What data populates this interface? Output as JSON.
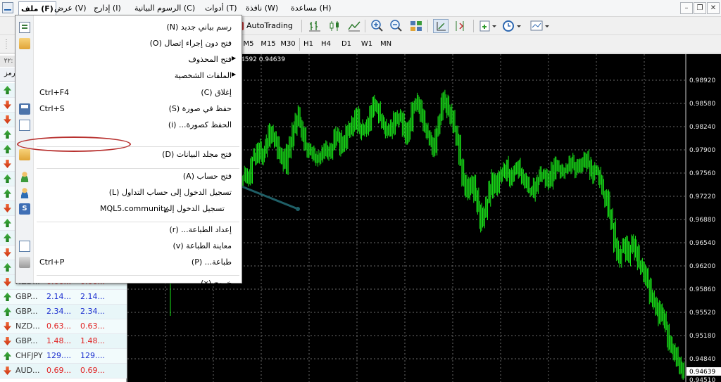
{
  "menubar": {
    "items": [
      {
        "label": "ملف (F)",
        "key": "file"
      },
      {
        "label": "عرض (V)",
        "key": "view"
      },
      {
        "label": "إدارج (I)",
        "key": "insert"
      },
      {
        "label": "الرسوم البيانية (C)",
        "key": "charts"
      },
      {
        "label": "أدوات (T)",
        "key": "tools"
      },
      {
        "label": "نافذة (W)",
        "key": "window"
      },
      {
        "label": "مساعدة (H)",
        "key": "help"
      }
    ]
  },
  "toolbar": {
    "autotrading_label": "AutoTrading",
    "search_placeholder": "",
    "search_value": "",
    "mql_badge": "5",
    "timeframes": [
      "M5",
      "M15",
      "M30",
      "H1",
      "H4",
      "D1",
      "W1",
      "MN"
    ]
  },
  "chart_info": "4592 0.94639",
  "chart_data": {
    "type": "bar",
    "yticks": [
      "0.98920",
      "0.98580",
      "0.98240",
      "0.97900",
      "0.97560",
      "0.97220",
      "0.96880",
      "0.96540",
      "0.96200",
      "0.95860",
      "0.95520",
      "0.95180",
      "0.94840",
      "0.94639",
      "0.94510"
    ],
    "current_price": "0.94639",
    "ylim": [
      0.9451,
      0.9918
    ],
    "closes": [
      0.976,
      0.977,
      0.9765,
      0.979,
      0.98,
      0.981,
      0.9795,
      0.9805,
      0.982,
      0.9835,
      0.983,
      0.9815,
      0.98,
      0.9795,
      0.978,
      0.98,
      0.982,
      0.984,
      0.986,
      0.985,
      0.9835,
      0.9815,
      0.981,
      0.9805,
      0.9795,
      0.979,
      0.98,
      0.981,
      0.9805,
      0.98,
      0.9815,
      0.983,
      0.9825,
      0.981,
      0.9815,
      0.983,
      0.984,
      0.985,
      0.986,
      0.9845,
      0.9835,
      0.984,
      0.985,
      0.987,
      0.988,
      0.9875,
      0.986,
      0.985,
      0.984,
      0.9835,
      0.9845,
      0.9855,
      0.986,
      0.9855,
      0.984,
      0.983,
      0.9845,
      0.987,
      0.988,
      0.9875,
      0.986,
      0.984,
      0.983,
      0.982,
      0.981,
      0.9835,
      0.9855,
      0.988,
      0.9885,
      0.987,
      0.986,
      0.984,
      0.982,
      0.979,
      0.976,
      0.974,
      0.975,
      0.976,
      0.974,
      0.972,
      0.969,
      0.971,
      0.973,
      0.9745,
      0.976,
      0.975,
      0.9765,
      0.977,
      0.978,
      0.977,
      0.976,
      0.9775,
      0.978,
      0.977,
      0.976,
      0.975,
      0.9745,
      0.974,
      0.975,
      0.976,
      0.977,
      0.9765,
      0.9755,
      0.976,
      0.9775,
      0.9785,
      0.978,
      0.977,
      0.9775,
      0.978,
      0.979,
      0.9785,
      0.9775,
      0.978,
      0.9785,
      0.979,
      0.978,
      0.977,
      0.9775,
      0.977,
      0.976,
      0.974,
      0.973,
      0.971,
      0.969,
      0.966,
      0.964,
      0.965,
      0.966,
      0.964,
      0.965,
      0.966,
      0.965,
      0.963,
      0.962,
      0.961,
      0.96,
      0.958,
      0.957,
      0.956,
      0.954,
      0.955,
      0.953,
      0.951,
      0.95,
      0.949,
      0.948,
      0.947,
      0.9464
    ]
  },
  "market_watch": {
    "time_label": "٢٢:",
    "header_label": "رمز",
    "rows": [
      {
        "dir": "up",
        "sym": "",
        "bid": "",
        "ask": ""
      },
      {
        "dir": "down",
        "sym": "",
        "bid": "",
        "ask": ""
      },
      {
        "dir": "down",
        "sym": "",
        "bid": "",
        "ask": ""
      },
      {
        "dir": "up",
        "sym": "",
        "bid": "",
        "ask": ""
      },
      {
        "dir": "up",
        "sym": "",
        "bid": "",
        "ask": ""
      },
      {
        "dir": "down",
        "sym": "",
        "bid": "",
        "ask": ""
      },
      {
        "dir": "up",
        "sym": "",
        "bid": "",
        "ask": ""
      },
      {
        "dir": "up",
        "sym": "",
        "bid": "",
        "ask": ""
      },
      {
        "dir": "down",
        "sym": "",
        "bid": "",
        "ask": ""
      },
      {
        "dir": "up",
        "sym": "",
        "bid": "",
        "ask": ""
      },
      {
        "dir": "up",
        "sym": "",
        "bid": "",
        "ask": ""
      },
      {
        "dir": "down",
        "sym": "",
        "bid": "",
        "ask": ""
      },
      {
        "dir": "up",
        "sym": "",
        "bid": "",
        "ask": ""
      },
      {
        "dir": "down",
        "sym": "NZD...",
        "bid": "0.66...",
        "ask": "0.66...",
        "color": "red"
      },
      {
        "dir": "up",
        "sym": "GBP...",
        "bid": "2.14...",
        "ask": "2.14...",
        "color": "blue"
      },
      {
        "dir": "up",
        "sym": "GBP...",
        "bid": "2.34...",
        "ask": "2.34...",
        "color": "blue"
      },
      {
        "dir": "down",
        "sym": "NZD...",
        "bid": "0.63...",
        "ask": "0.63...",
        "color": "red"
      },
      {
        "dir": "down",
        "sym": "GBP...",
        "bid": "1.48...",
        "ask": "1.48...",
        "color": "red"
      },
      {
        "dir": "up",
        "sym": "CHFJPY",
        "bid": "129....",
        "ask": "129....",
        "color": "blue"
      },
      {
        "dir": "down",
        "sym": "AUD...",
        "bid": "0.69...",
        "ask": "0.69...",
        "color": "red"
      }
    ]
  },
  "file_menu": {
    "items": [
      {
        "label": "رسم بياني جديد (N)",
        "accel": "",
        "icon": "new-chart-icon",
        "iconClass": "ico-doc"
      },
      {
        "label": "فتح دون إجراء إتصال (O)",
        "accel": "",
        "icon": "open-folder-icon",
        "iconClass": "ico-folder"
      },
      {
        "label": "فتح المحذوف",
        "accel": "",
        "icon": "",
        "sub": true
      },
      {
        "label": "الملفات الشخصية",
        "accel": "",
        "icon": "",
        "sub": true
      },
      {
        "label": "إغلاق (C)",
        "accel": "Ctrl+F4",
        "icon": ""
      },
      {
        "label": "حفظ في صورة (S)",
        "accel": "Ctrl+S",
        "icon": "save-icon",
        "iconClass": "ico-save"
      },
      {
        "label": "الحفظ كصورة... (i)",
        "accel": "",
        "icon": "save-as-picture-icon",
        "iconClass": "ico-copy"
      },
      {
        "label": "فتح مجلد البيانات (D)",
        "accel": "",
        "icon": "data-folder-icon",
        "iconClass": "ico-folder",
        "sep_before": true
      },
      {
        "label": "فتح حساب (A)",
        "accel": "",
        "icon": "open-account-icon",
        "iconClass": "ico-user",
        "sep_before": true
      },
      {
        "label": "تسجيل الدخول إلى حساب التداول (L)",
        "accel": "",
        "icon": "login-trade-icon",
        "iconClass": "ico-user2"
      },
      {
        "label": "تسجيل الدخول إلى",
        "accel": "",
        "mid": "MQL5.community",
        "icon": "mql5-login-icon",
        "iconClass": "ico-mql",
        "iconText": "S"
      },
      {
        "label": "إعداد الطباعة... (r)",
        "accel": "",
        "icon": "",
        "sep_before": true
      },
      {
        "label": "معاينة الطباعة (v)",
        "accel": "",
        "icon": "print-preview-icon",
        "iconClass": "ico-copy"
      },
      {
        "label": "طباعة... (P)",
        "accel": "Ctrl+P",
        "icon": "print-icon",
        "iconClass": "ico-print"
      },
      {
        "label": "خروج (x)",
        "accel": "",
        "icon": "",
        "sep_before": true
      }
    ]
  }
}
